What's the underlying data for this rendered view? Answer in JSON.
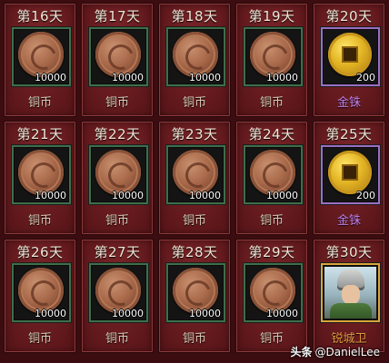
{
  "cells": [
    {
      "day": "第16天",
      "qty": "10000",
      "name": "铜币",
      "item": "copper-coin"
    },
    {
      "day": "第17天",
      "qty": "10000",
      "name": "铜币",
      "item": "copper-coin"
    },
    {
      "day": "第18天",
      "qty": "10000",
      "name": "铜币",
      "item": "copper-coin"
    },
    {
      "day": "第19天",
      "qty": "10000",
      "name": "铜币",
      "item": "copper-coin"
    },
    {
      "day": "第20天",
      "qty": "200",
      "name": "金铢",
      "item": "gold-coin"
    },
    {
      "day": "第21天",
      "qty": "10000",
      "name": "铜币",
      "item": "copper-coin"
    },
    {
      "day": "第22天",
      "qty": "10000",
      "name": "铜币",
      "item": "copper-coin"
    },
    {
      "day": "第23天",
      "qty": "10000",
      "name": "铜币",
      "item": "copper-coin"
    },
    {
      "day": "第24天",
      "qty": "10000",
      "name": "铜币",
      "item": "copper-coin"
    },
    {
      "day": "第25天",
      "qty": "200",
      "name": "金铢",
      "item": "gold-coin"
    },
    {
      "day": "第26天",
      "qty": "10000",
      "name": "铜币",
      "item": "copper-coin"
    },
    {
      "day": "第27天",
      "qty": "10000",
      "name": "铜币",
      "item": "copper-coin"
    },
    {
      "day": "第28天",
      "qty": "10000",
      "name": "铜币",
      "item": "copper-coin"
    },
    {
      "day": "第29天",
      "qty": "10000",
      "name": "铜币",
      "item": "copper-coin"
    },
    {
      "day": "第30天",
      "qty": "",
      "name": "锐城卫",
      "item": "hero-portrait"
    }
  ],
  "watermark": {
    "head": "头条",
    "handle": "@DanielLee"
  },
  "colors": {
    "panel_bg": "#6a1e22",
    "copper_border": "#3d6f4a",
    "gold_border": "#9a6fc2",
    "hero_border": "#d9a53a",
    "copper_name": "#d8c8b4",
    "gold_name": "#c07ee6",
    "hero_name": "#e2973b"
  }
}
